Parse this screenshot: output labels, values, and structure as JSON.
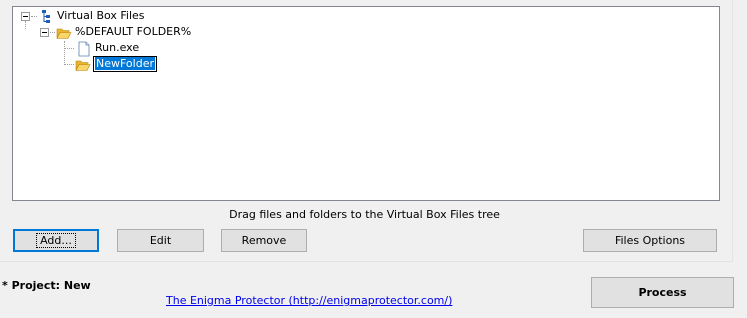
{
  "tree": {
    "root": {
      "label": "Virtual Box Files",
      "icon": "tree-root-icon"
    },
    "default_folder": {
      "label": "%DEFAULT FOLDER%",
      "icon": "open-folder-icon"
    },
    "file": {
      "label": "Run.exe",
      "icon": "file-icon"
    },
    "new_folder": {
      "label": "NewFolder",
      "icon": "folder-icon",
      "editing": true
    }
  },
  "hint": "Drag files and folders to the Virtual Box Files tree",
  "buttons": {
    "add": "Add...",
    "edit": "Edit",
    "remove": "Remove",
    "files_options": "Files Options"
  },
  "project_status": "* Project: New",
  "link": "The Enigma Protector (http://enigmaprotector.com/)",
  "process": "Process",
  "colors": {
    "selection": "#0078d7",
    "folder": "#f5c842",
    "link": "#0000ee"
  }
}
